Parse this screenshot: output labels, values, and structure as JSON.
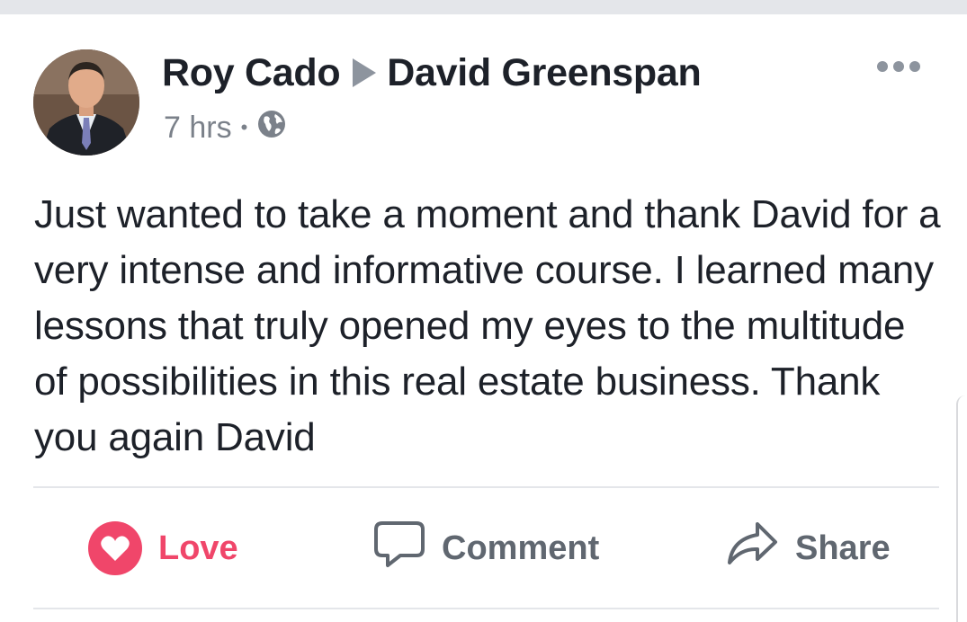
{
  "post": {
    "author": "Roy Cado",
    "target": "David Greenspan",
    "time": "7 hrs",
    "separator": "•",
    "privacy_icon": "globe-icon",
    "more_icon": "more-options-icon",
    "text": "Just wanted to take a moment and thank David for a very intense and informative course. I learned many lessons that truly opened my eyes to the multitude of possibilities in this real estate business. Thank you again David"
  },
  "actions": {
    "love_label": "Love",
    "comment_label": "Comment",
    "share_label": "Share"
  },
  "colors": {
    "love": "#f0466a",
    "text": "#1d2129",
    "secondary": "#606770",
    "divider": "#e4e6ea"
  }
}
